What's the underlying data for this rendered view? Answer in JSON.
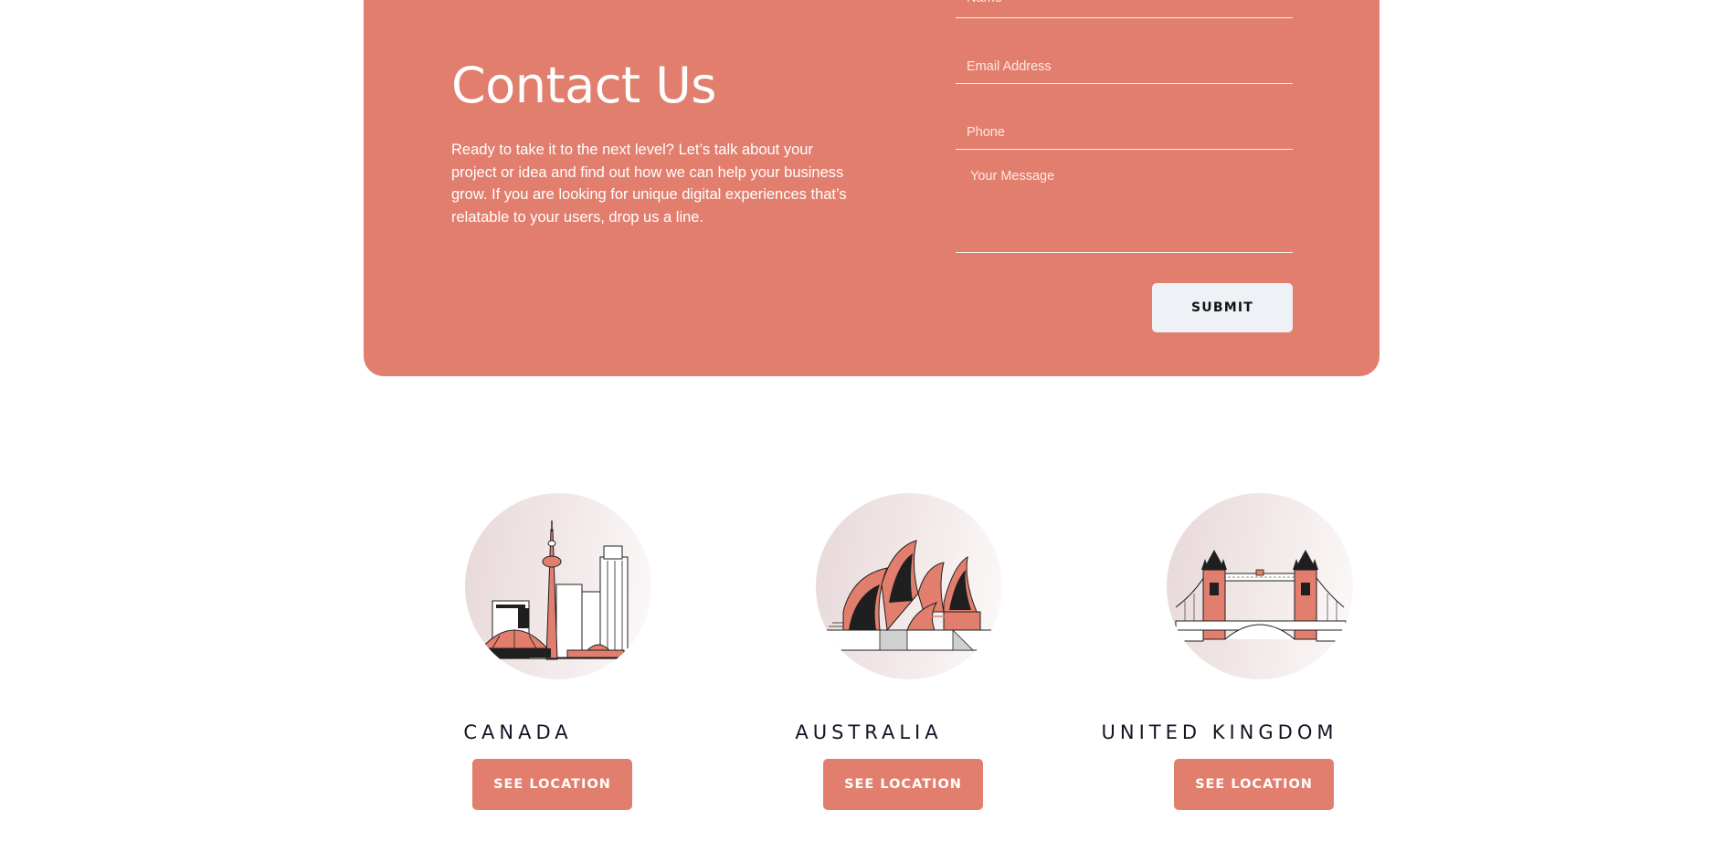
{
  "contact": {
    "title": "Contact Us",
    "description": "Ready to take it to the next level? Let’s talk about your project or idea and find out how we can help your business grow. If you are looking for unique digital experiences that’s relatable to your users, drop us a line.",
    "fields": {
      "name_placeholder": "Name",
      "email_placeholder": "Email Address",
      "phone_placeholder": "Phone",
      "message_placeholder": "Your Message"
    },
    "submit_label": "SUBMIT"
  },
  "locations": [
    {
      "name": "CANADA",
      "button_label": "SEE LOCATION",
      "icon": "toronto-skyline-icon"
    },
    {
      "name": "AUSTRALIA",
      "button_label": "SEE LOCATION",
      "icon": "sydney-opera-house-icon"
    },
    {
      "name": "UNITED KINGDOM",
      "button_label": "SEE LOCATION",
      "icon": "tower-bridge-icon"
    }
  ],
  "colors": {
    "accent": "#e27e6d",
    "submit_bg": "#eef1f5",
    "text_dark": "#141424"
  }
}
